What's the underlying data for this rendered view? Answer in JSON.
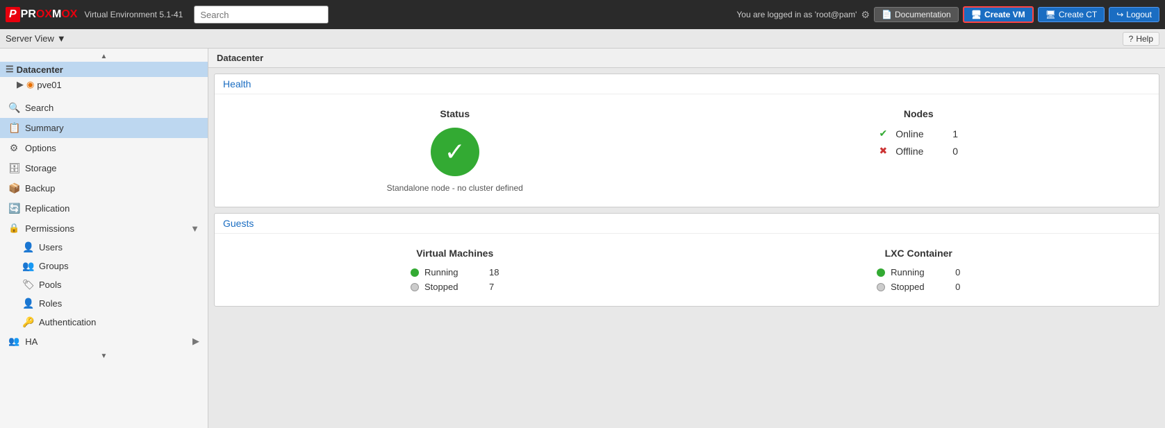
{
  "topbar": {
    "logo_brand": "PR",
    "logo_ox": "OX",
    "logo_m": "M",
    "logo_ox2": "OX",
    "app_name": "PROXMOX",
    "version": "Virtual Environment 5.1-41",
    "search_placeholder": "Search",
    "user_info": "You are logged in as 'root@pam'",
    "doc_btn": "Documentation",
    "create_vm_btn": "Create VM",
    "create_ct_btn": "Create CT",
    "logout_btn": "Logout"
  },
  "secondbar": {
    "server_view_label": "Server View",
    "help_btn": "Help"
  },
  "tree": {
    "datacenter_label": "Datacenter",
    "node_label": "pve01"
  },
  "nav": {
    "search_label": "Search",
    "summary_label": "Summary",
    "options_label": "Options",
    "storage_label": "Storage",
    "backup_label": "Backup",
    "replication_label": "Replication",
    "permissions_label": "Permissions",
    "users_label": "Users",
    "groups_label": "Groups",
    "pools_label": "Pools",
    "roles_label": "Roles",
    "authentication_label": "Authentication",
    "ha_label": "HA"
  },
  "breadcrumb": {
    "label": "Datacenter"
  },
  "health": {
    "section_title": "Health",
    "status_title": "Status",
    "check_symbol": "✓",
    "standalone_msg": "Standalone node - no cluster defined",
    "nodes_title": "Nodes",
    "online_label": "Online",
    "online_count": "1",
    "offline_label": "Offline",
    "offline_count": "0"
  },
  "guests": {
    "section_title": "Guests",
    "vm_title": "Virtual Machines",
    "vm_running_label": "Running",
    "vm_running_count": "18",
    "vm_stopped_label": "Stopped",
    "vm_stopped_count": "7",
    "lxc_title": "LXC Container",
    "lxc_running_label": "Running",
    "lxc_running_count": "0",
    "lxc_stopped_label": "Stopped",
    "lxc_stopped_count": "0"
  }
}
